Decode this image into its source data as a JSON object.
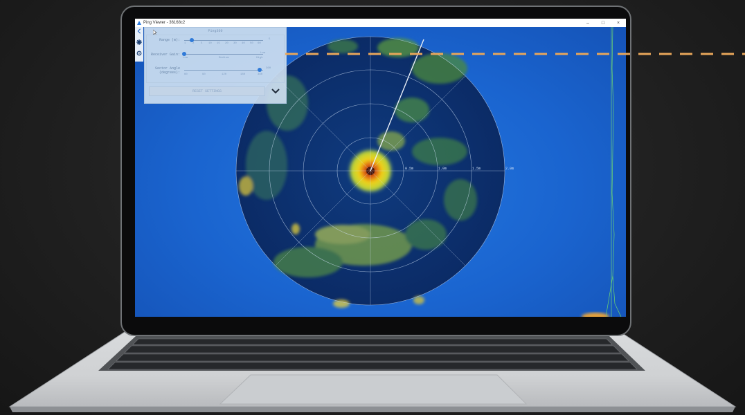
{
  "window": {
    "title": "Ping Viewer - 36168c2",
    "min_label": "–",
    "max_label": "□",
    "close_label": "×"
  },
  "panel": {
    "title": "Ping360",
    "range_label": "Range (m):",
    "range_ticks": [
      "1",
      "2",
      "5",
      "10",
      "15",
      "20",
      "30",
      "40",
      "50",
      "60"
    ],
    "range_value": "5",
    "receiver_gain_label": "Receiver Gain:",
    "gain_options": [
      "Low",
      "Medium",
      "High"
    ],
    "gain_value": "Low",
    "sector_label": "Sector Angle",
    "sector_unit": "(degrees):",
    "sector_ticks": [
      "60",
      "90",
      "120",
      "180",
      "360"
    ],
    "sector_value": "360",
    "reset_label": "RESET SETTINGS"
  },
  "sonar": {
    "ring_labels": [
      "0.5m",
      "1.0m",
      "1.5m",
      "2.0m"
    ]
  },
  "colors": {
    "accent": "#2f7ad8",
    "background": "#1d63c9",
    "sonar_bg": "#0c2f6e"
  }
}
